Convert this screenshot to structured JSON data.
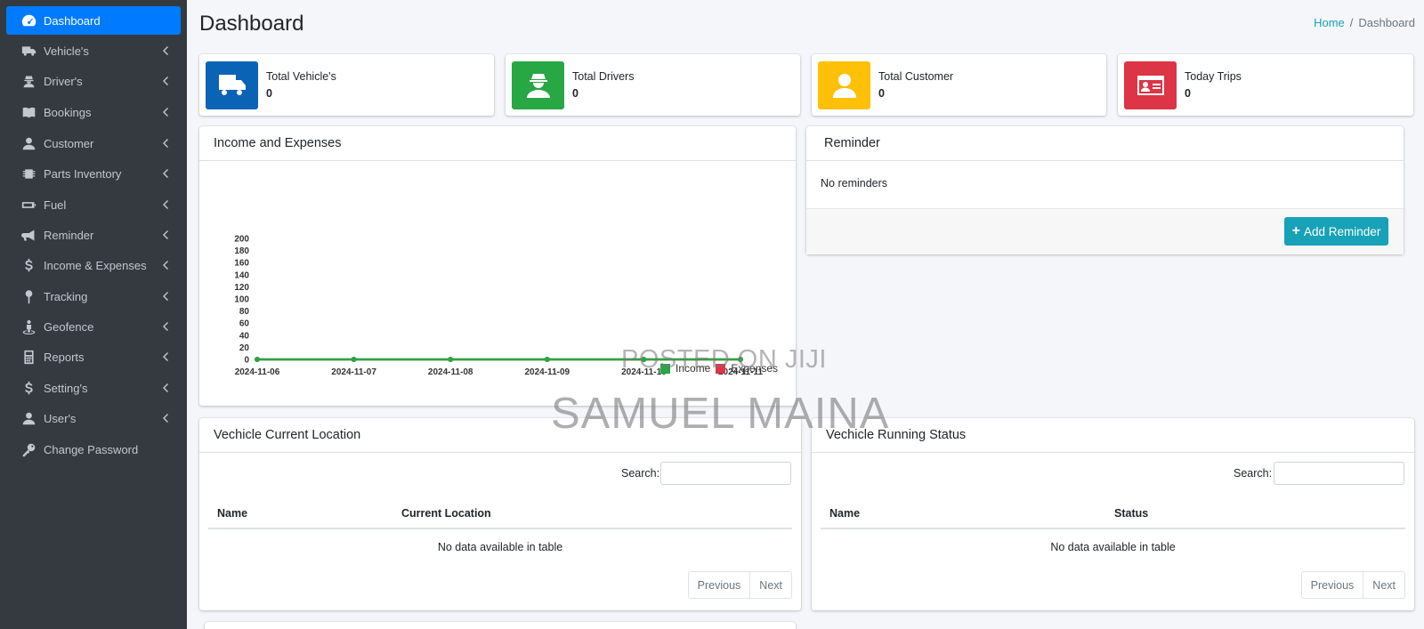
{
  "sidebar": {
    "items": [
      {
        "label": "Dashboard",
        "icon": "dashboard-icon",
        "active": true
      },
      {
        "label": "Vehicle's",
        "icon": "truck-icon"
      },
      {
        "label": "Driver's",
        "icon": "driver-icon"
      },
      {
        "label": "Bookings",
        "icon": "book-icon"
      },
      {
        "label": "Customer",
        "icon": "user-icon"
      },
      {
        "label": "Parts Inventory",
        "icon": "chip-icon"
      },
      {
        "label": "Fuel",
        "icon": "battery-icon"
      },
      {
        "label": "Reminder",
        "icon": "bullhorn-icon"
      },
      {
        "label": "Income & Expenses",
        "icon": "dollar-icon"
      },
      {
        "label": "Tracking",
        "icon": "map-pin-icon"
      },
      {
        "label": "Geofence",
        "icon": "street-view-icon"
      },
      {
        "label": "Reports",
        "icon": "calculator-icon"
      },
      {
        "label": "Setting's",
        "icon": "dollar-icon"
      },
      {
        "label": "User's",
        "icon": "user-icon"
      },
      {
        "label": "Change Password",
        "icon": "key-icon"
      }
    ]
  },
  "header": {
    "title": "Dashboard",
    "breadcrumb": {
      "home": "Home",
      "separator": "/",
      "current": "Dashboard"
    }
  },
  "stats": [
    {
      "label": "Total Vehicle's",
      "value": "0",
      "icon": "truck-icon",
      "color": "#0b63b6"
    },
    {
      "label": "Total Drivers",
      "value": "0",
      "icon": "driver-icon",
      "color": "#28a745"
    },
    {
      "label": "Total Customer",
      "value": "0",
      "icon": "user-icon",
      "color": "#ffc107"
    },
    {
      "label": "Today Trips",
      "value": "0",
      "icon": "id-card-icon",
      "color": "#dc3545"
    }
  ],
  "income_card": {
    "title": "Income and Expenses",
    "chart_data": {
      "type": "line",
      "x": [
        "2024-11-06",
        "2024-11-07",
        "2024-11-08",
        "2024-11-09",
        "2024-11-10",
        "2024-11-11"
      ],
      "series": [
        {
          "name": "Income",
          "values": [
            0,
            0,
            0,
            0,
            0,
            0
          ],
          "color": "#28a745"
        },
        {
          "name": "Expenses",
          "values": [
            0,
            0,
            0,
            0,
            0,
            0
          ],
          "color": "#dc3545"
        }
      ],
      "yticks": [
        0,
        20,
        40,
        60,
        80,
        100,
        120,
        140,
        160,
        180,
        200
      ],
      "ylim": [
        0,
        200
      ],
      "grid": false,
      "legend": "bottom-right"
    }
  },
  "reminder_card": {
    "title": "Reminder",
    "empty_text": "No reminders",
    "add_button": "Add Reminder"
  },
  "location_card": {
    "title": "Vechicle Current Location",
    "search_label": "Search:",
    "columns": [
      "Name",
      "Current Location"
    ],
    "empty_text": "No data available in table",
    "prev": "Previous",
    "next": "Next"
  },
  "status_card": {
    "title": "Vechicle Running Status",
    "search_label": "Search:",
    "columns": [
      "Name",
      "Status"
    ],
    "empty_text": "No data available in table",
    "prev": "Previous",
    "next": "Next"
  },
  "watermark": {
    "line1": "POSTED ON JIJI",
    "line2": "SAMUEL MAINA"
  }
}
